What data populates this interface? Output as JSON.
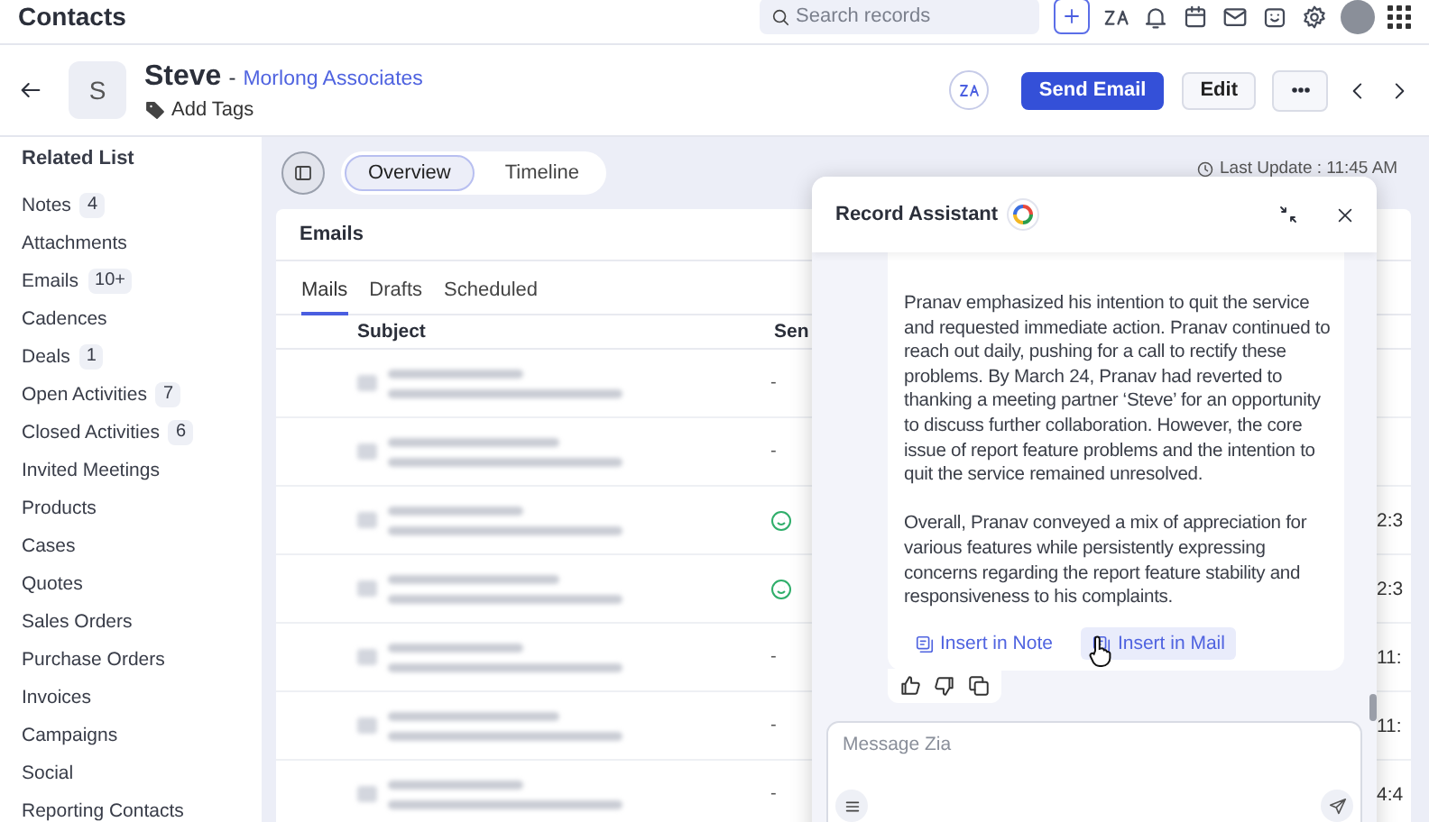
{
  "top_bar": {
    "title": "Contacts",
    "search": {
      "placeholder": "Search records"
    }
  },
  "record": {
    "initial": "S",
    "name": "Steve",
    "separator": "-",
    "company": "Morlong Associates",
    "add_tags": "Add Tags",
    "buttons": [
      {
        "label": "Send Email",
        "kind": "primary"
      },
      {
        "label": "Edit",
        "kind": "secondary"
      }
    ]
  },
  "sidebar": {
    "title": "Related List",
    "items": [
      {
        "label": "Notes",
        "count": "4"
      },
      {
        "label": "Attachments"
      },
      {
        "label": "Emails",
        "count": "10+"
      },
      {
        "label": "Cadences"
      },
      {
        "label": "Deals",
        "count": "1"
      },
      {
        "label": "Open Activities",
        "count": "7"
      },
      {
        "label": "Closed Activities",
        "count": "6"
      },
      {
        "label": "Invited Meetings"
      },
      {
        "label": "Products"
      },
      {
        "label": "Cases"
      },
      {
        "label": "Quotes"
      },
      {
        "label": "Sales Orders"
      },
      {
        "label": "Purchase Orders"
      },
      {
        "label": "Invoices"
      },
      {
        "label": "Campaigns"
      },
      {
        "label": "Social"
      },
      {
        "label": "Reporting Contacts"
      }
    ]
  },
  "view_tabs": [
    {
      "label": "Overview",
      "selected": true
    },
    {
      "label": "Timeline",
      "selected": false
    }
  ],
  "last_update": "Last Update : 11:45 AM",
  "emails": {
    "title": "Emails",
    "tabs": [
      {
        "label": "Mails",
        "selected": true
      },
      {
        "label": "Drafts",
        "selected": false
      },
      {
        "label": "Scheduled",
        "selected": false
      }
    ],
    "columns": [
      "Subject",
      "Sen"
    ],
    "rows": [
      {
        "sent": "-",
        "sentiment": false
      },
      {
        "sent": "-",
        "sentiment": false
      },
      {
        "sentiment": true,
        "time": "2:3"
      },
      {
        "sentiment": true,
        "time": "2:3"
      },
      {
        "sent": "-",
        "sentiment": false,
        "time": "11:"
      },
      {
        "sent": "-",
        "sentiment": false,
        "time": "11:"
      },
      {
        "sent": "-",
        "sentiment": false,
        "time": "4:4"
      }
    ]
  },
  "assistant": {
    "title": "Record Assistant",
    "paragraphs": [
      "Pranav emphasized his intention to quit the service and requested immediate action. Pranav continued to reach out daily, pushing for a call to rectify these problems. By March 24, Pranav had reverted to thanking a meeting partner ‘Steve’ for an opportunity to discuss further collaboration. However, the core issue of report feature problems and the intention to quit the service remained unresolved.",
      "Overall, Pranav conveyed a mix of appreciation for various features while persistently expressing concerns regarding the report feature stability and responsiveness to his complaints."
    ],
    "actions": [
      {
        "label": "Insert in Note",
        "hovered": false
      },
      {
        "label": "Insert in Mail",
        "hovered": true
      }
    ],
    "message": {
      "placeholder": "Message Zia"
    }
  }
}
